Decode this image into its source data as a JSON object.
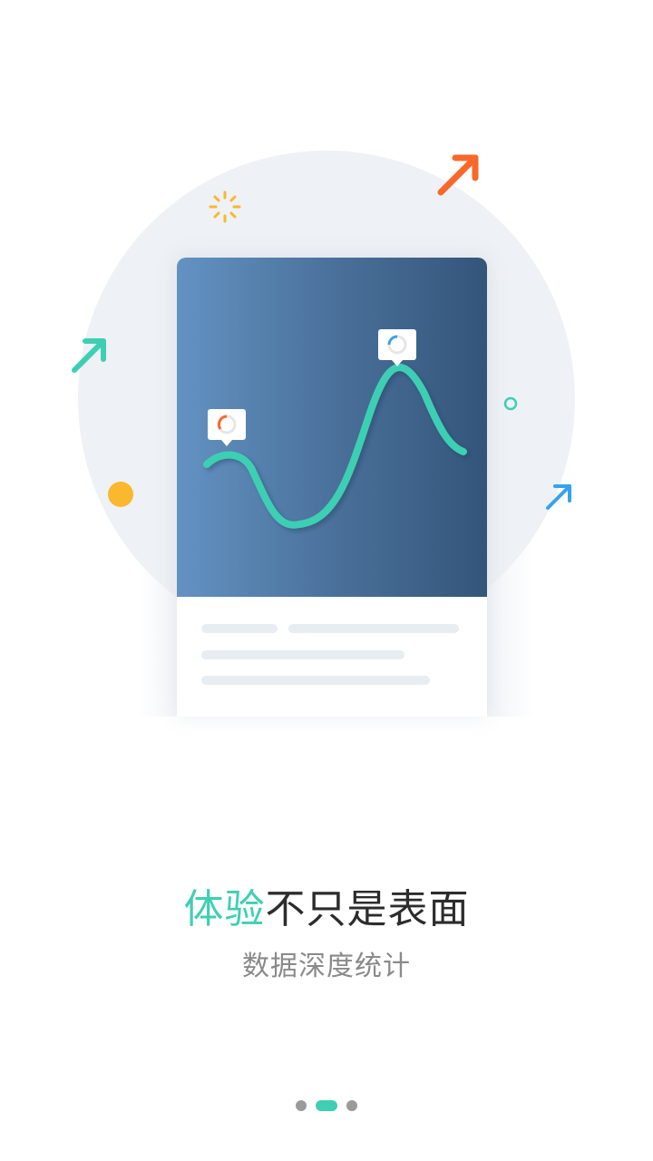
{
  "illustration": {
    "colors": {
      "circle_bg": "#eef1f5",
      "chart_gradient_start": "#6392c2",
      "chart_gradient_end": "#34557a",
      "curve": "#3ecfb3",
      "arrow_orange": "#f7692b",
      "arrow_teal": "#3ecfb3",
      "arrow_blue": "#35a3ef",
      "dot_yellow": "#f9b82d",
      "sparkle_yellow": "#f9b82d"
    },
    "icons": [
      "sparkle-icon",
      "arrow-up-right-icon",
      "ring-icon",
      "donut-icon"
    ]
  },
  "headline": {
    "accent_text": "体验",
    "rest_text": "不只是表面"
  },
  "subheadline": "数据深度统计",
  "pager": {
    "total": 3,
    "active_index": 1,
    "colors": {
      "active": "#3ecfb3",
      "inactive": "#9a9a9a"
    }
  }
}
